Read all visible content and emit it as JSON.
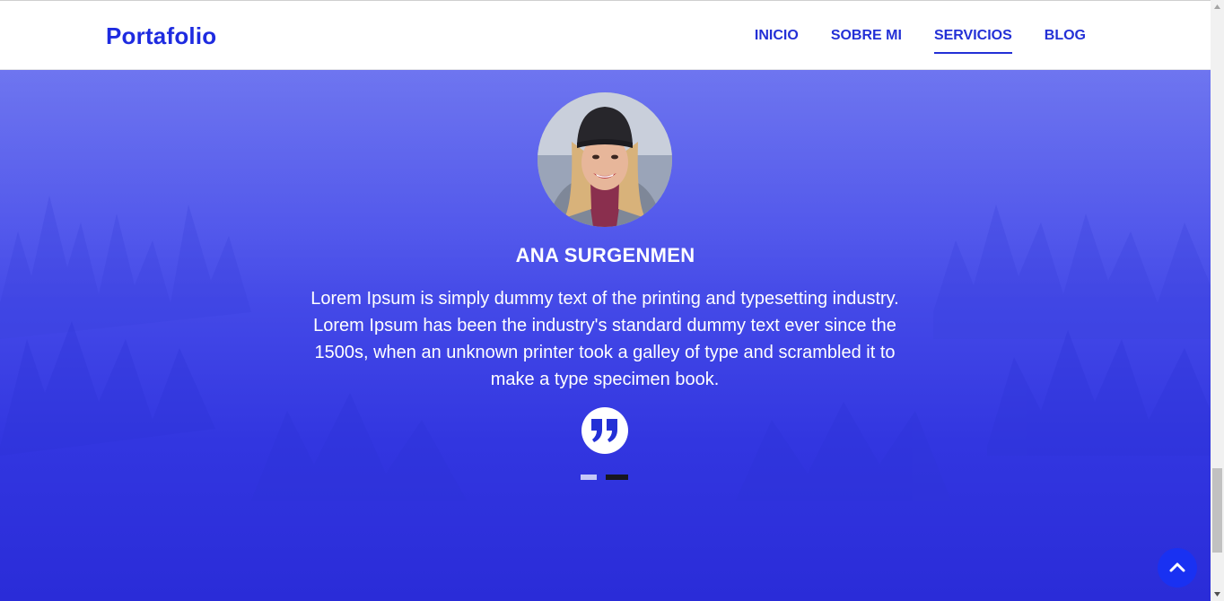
{
  "navbar": {
    "brand": "Portafolio",
    "items": [
      {
        "label": "INICIO",
        "active": false
      },
      {
        "label": "SOBRE MI",
        "active": false
      },
      {
        "label": "SERVICIOS",
        "active": true
      },
      {
        "label": "BLOG",
        "active": false
      }
    ]
  },
  "testimonial": {
    "author": "ANA SURGENMEN",
    "text": "Lorem Ipsum is simply dummy text of the printing and typesetting industry. Lorem Ipsum has been the industry's standard dummy text ever since the 1500s, when an unknown printer took a galley of type and scrambled it to make a type specimen book.",
    "quote_icon": "quote-right-icon",
    "carousel": {
      "slides": 2,
      "active_index": 1
    }
  },
  "back_to_top": {
    "icon": "chevron-up-icon"
  },
  "colors": {
    "brand": "#1e2be0",
    "nav_link": "#2330d6",
    "hero_top": "#5e66ee",
    "hero_bottom": "#2a2cd8",
    "back_to_top": "#1931f2",
    "dot_active": "#17161f",
    "dot_inactive": "#c5c8f7"
  }
}
